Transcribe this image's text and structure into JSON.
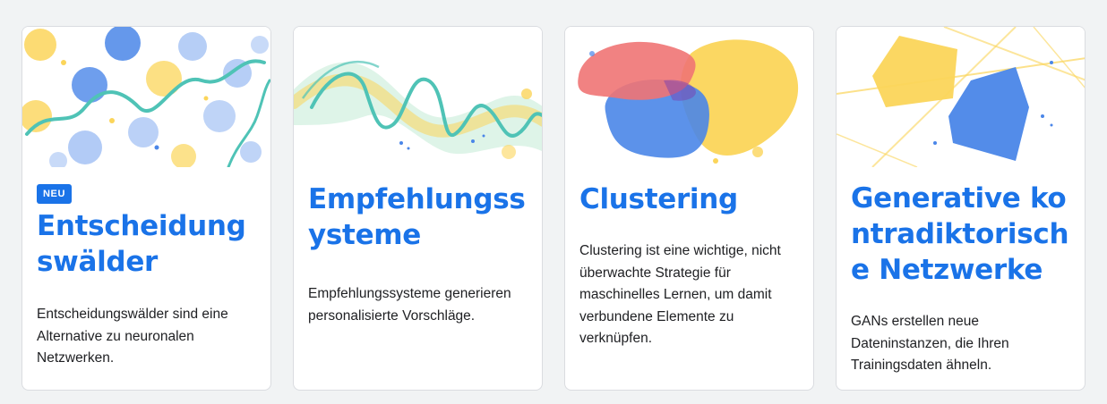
{
  "cards": [
    {
      "badge": "NEU",
      "title": "Entscheidungswälder",
      "description": "Entscheidungswälder sind eine Alternative zu neuronalen Netzwerken.",
      "image": "dots-and-wavy-lines-illustration"
    },
    {
      "title": "Empfehlungssysteme",
      "description": "Empfehlungssysteme generieren personalisierte Vorschläge.",
      "image": "wavy-ribbon-illustration"
    },
    {
      "title": "Clustering",
      "description": "Clustering ist eine wichtige, nicht überwachte Strategie für maschinelles Lernen, um damit verbundene Elemente zu verknüpfen.",
      "image": "overlapping-blobs-illustration"
    },
    {
      "title": "Generative kontradiktorische Netzwerke",
      "description": "GANs erstellen neue Dateninstanzen, die Ihren Trainingsdaten ähneln.",
      "image": "intersecting-shapes-illustration"
    }
  ],
  "colors": {
    "accent": "#1a73e8",
    "text": "#202124",
    "background": "#f1f3f4",
    "card_border": "#dadce0",
    "illustration_blue": "#4a86e8",
    "illustration_yellow": "#fbd55a",
    "illustration_teal": "#4fc3b6",
    "illustration_red": "#f07474"
  }
}
